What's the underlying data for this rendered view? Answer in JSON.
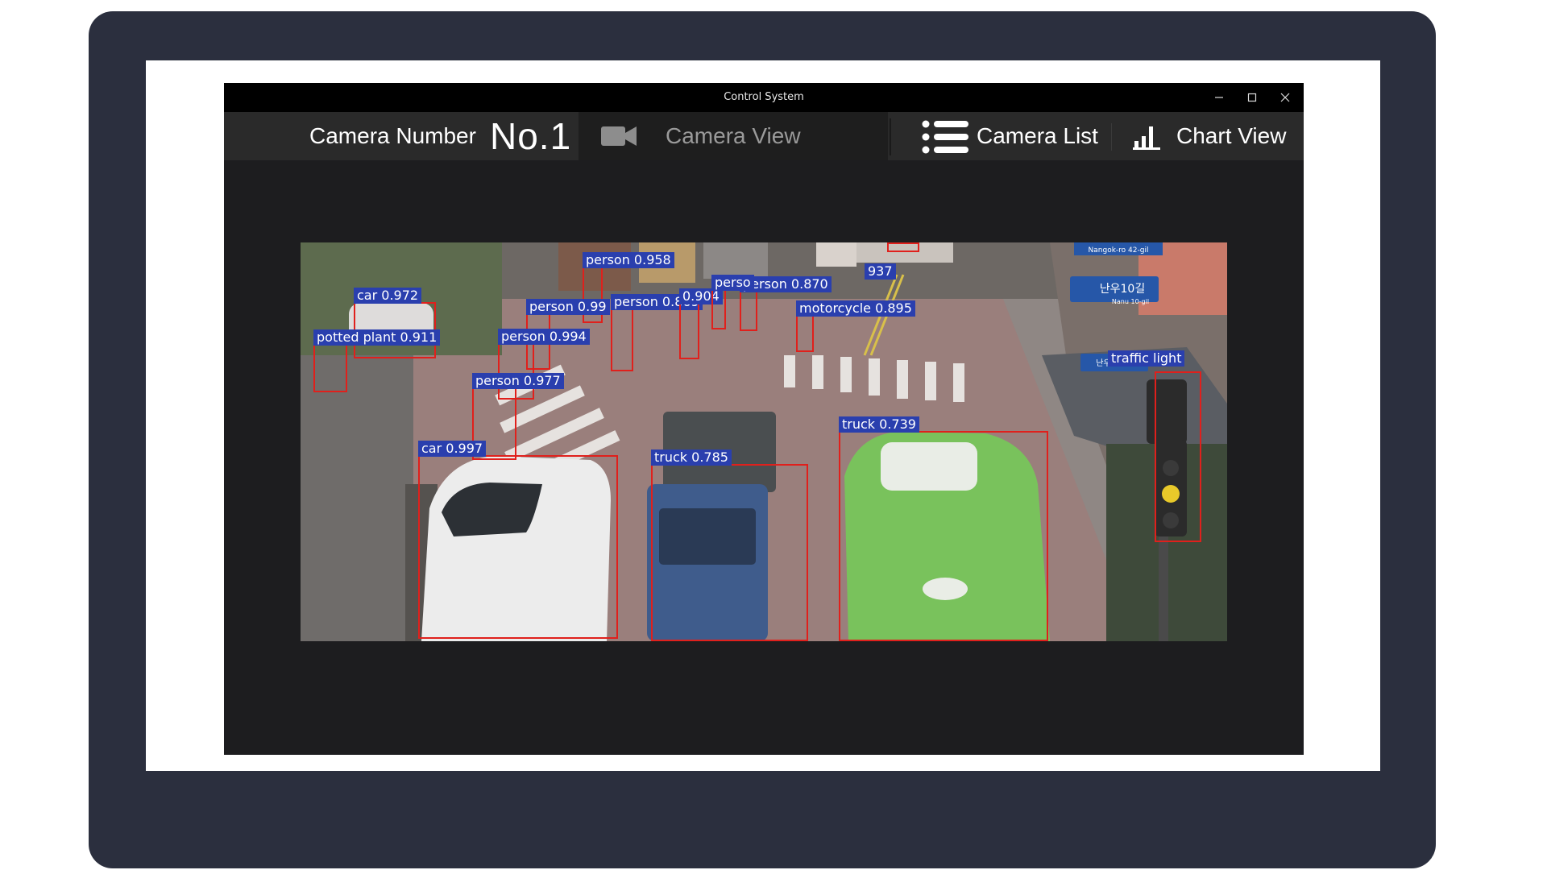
{
  "window": {
    "title": "Control System"
  },
  "toolbar": {
    "camera_number_label": "Camera Number",
    "camera_number_value": "No.1",
    "camera_view_label": "Camera View",
    "camera_list_label": "Camera List",
    "chart_view_label": "Chart View"
  },
  "icons": {
    "camera_view": "video-camera-icon",
    "camera_list": "list-icon",
    "chart_view": "bar-chart-icon"
  },
  "colors": {
    "detection_box": "#e0201c",
    "detection_label_bg": "#2a3fae",
    "toolbar_bg": "#2a2a2a",
    "titlebar_bg": "#000000"
  },
  "detections": [
    {
      "label": "car 0.972"
    },
    {
      "label": "potted plant 0.911"
    },
    {
      "label": "person 0.958"
    },
    {
      "label": "person 0.99"
    },
    {
      "label": "person 0.869"
    },
    {
      "label": "0.904"
    },
    {
      "label": "person 0.870"
    },
    {
      "label": "937"
    },
    {
      "label": "perso"
    },
    {
      "label": "motorcycle 0.895"
    },
    {
      "label": "person 0.994"
    },
    {
      "label": "person 0.977"
    },
    {
      "label": "car 0.997"
    },
    {
      "label": "truck 0.785"
    },
    {
      "label": "truck 0.739"
    },
    {
      "label": "traffic light"
    }
  ],
  "scene_signs": [
    "Nangok-ro 42-gil",
    "난우10길",
    "Nanu 10-gil",
    "난우10가길"
  ]
}
